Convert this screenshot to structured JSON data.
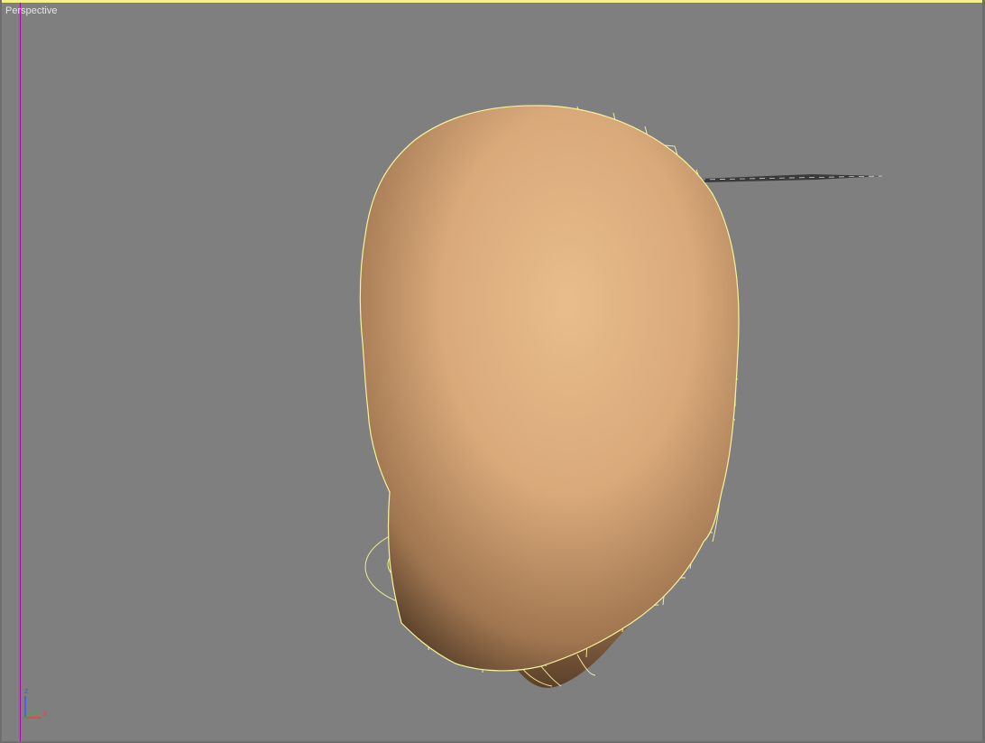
{
  "viewport": {
    "label": "Perspective",
    "background_color": "#7f7f7f",
    "active_border_color": "#f4f08a",
    "wireframe_color": "#f6f29a",
    "model_base_color": "#d9a97a"
  },
  "axis_tripod": {
    "z_label": "z",
    "y_label": "y",
    "x_label": "x",
    "z_color": "#3a5cff",
    "y_color": "#3bb33b",
    "x_color": "#ff3a3a"
  }
}
